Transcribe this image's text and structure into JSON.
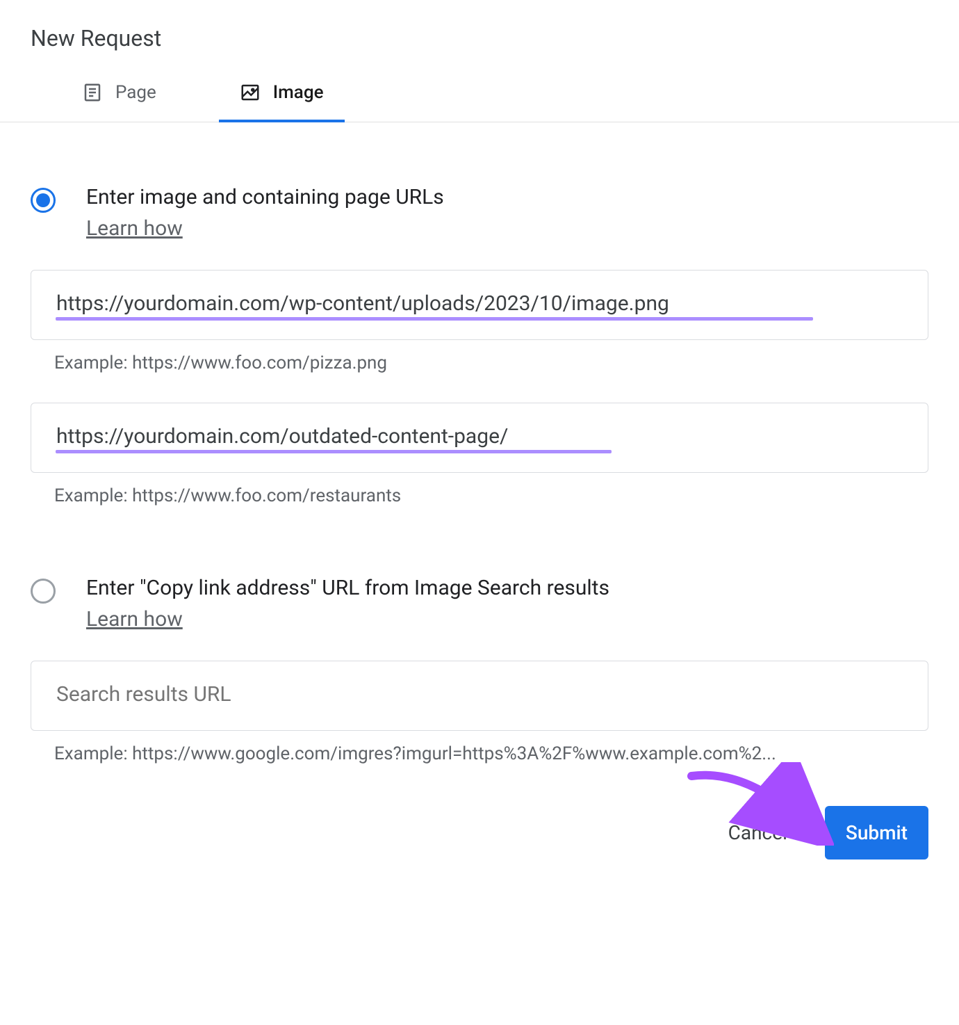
{
  "title": "New Request",
  "tabs": {
    "page": "Page",
    "image": "Image"
  },
  "option1": {
    "title": "Enter image and containing page URLs",
    "learn": "Learn how",
    "input1_value": "https://yourdomain.com/wp-content/uploads/2023/10/image.png",
    "input1_example": "Example: https://www.foo.com/pizza.png",
    "input2_value": "https://yourdomain.com/outdated-content-page/",
    "input2_example": "Example: https://www.foo.com/restaurants"
  },
  "option2": {
    "title": "Enter \"Copy link address\" URL from Image Search results",
    "learn": "Learn how",
    "input_placeholder": "Search results URL",
    "input_example": "Example: https://www.google.com/imgres?imgurl=https%3A%2F%www.example.com%2..."
  },
  "footer": {
    "cancel": "Cancel",
    "submit": "Submit"
  }
}
